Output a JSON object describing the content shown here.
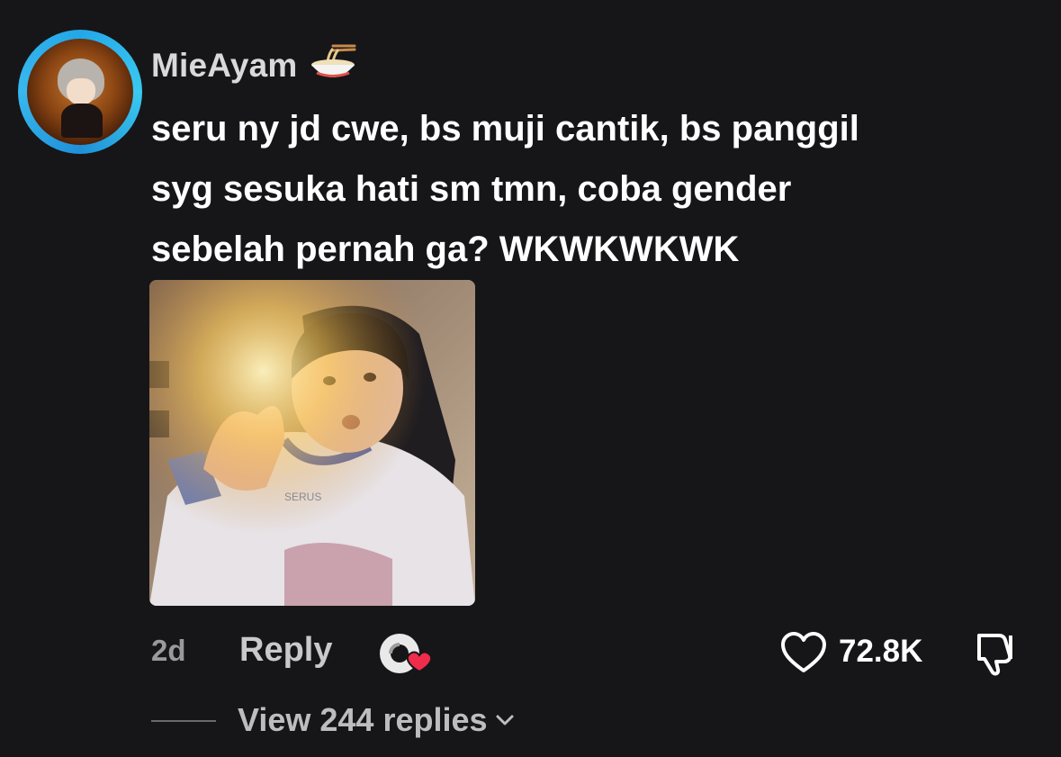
{
  "comment": {
    "username": "MieAyam",
    "username_icon": "noodle-bowl-icon",
    "text_lines": [
      "seru ny jd cwe, bs muji cantik, bs panggil",
      "syg sesuka hati sm tmn, coba gender",
      "sebelah pernah ga? WKWKWKWK"
    ],
    "image_caption": "SERUS",
    "time": "2d",
    "reply_label": "Reply",
    "like_count": "72.8K",
    "view_replies_label": "View 244 replies"
  },
  "colors": {
    "background": "#161618",
    "avatar_ring": "#24a7e8",
    "like_heart": "#ffffff",
    "sticker_heart": "#ef2c4c"
  },
  "icons": {
    "like": "heart-outline-icon",
    "dislike": "thumbs-down-icon",
    "sticker": "gif-sticker-icon",
    "expand": "chevron-down-icon"
  }
}
